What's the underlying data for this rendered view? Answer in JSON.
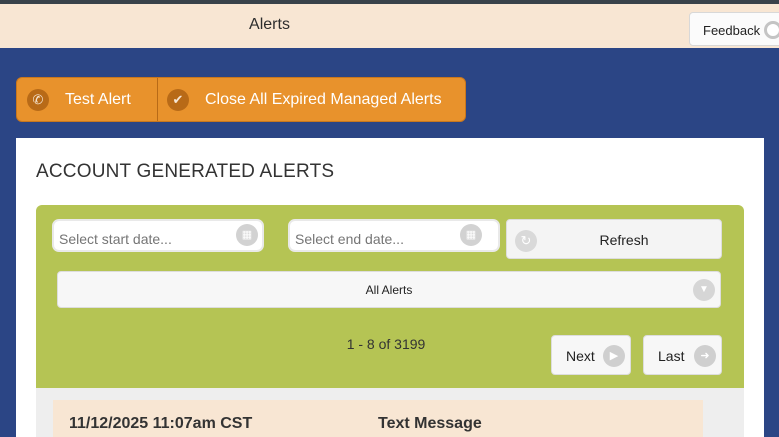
{
  "header": {
    "title": "Alerts",
    "feedback_label": "Feedback"
  },
  "actions": {
    "test_alert": "Test Alert",
    "close_expired": "Close All Expired Managed Alerts"
  },
  "panel": {
    "title": "ACCOUNT GENERATED ALERTS",
    "filters": {
      "start_placeholder": "Select start date...",
      "end_placeholder": "Select end date...",
      "refresh_label": "Refresh",
      "alert_type_selected": "All Alerts"
    },
    "pagination": {
      "summary": "1 - 8 of 3199",
      "next_label": "Next",
      "last_label": "Last"
    },
    "alerts": [
      {
        "time": "11/12/2025 11:07am CST",
        "type": "Text Message"
      }
    ]
  },
  "colors": {
    "primary_bg": "#2b4585",
    "accent_orange": "#e8922c",
    "filter_green": "#b5c454",
    "header_bg": "#f8e6d3"
  }
}
